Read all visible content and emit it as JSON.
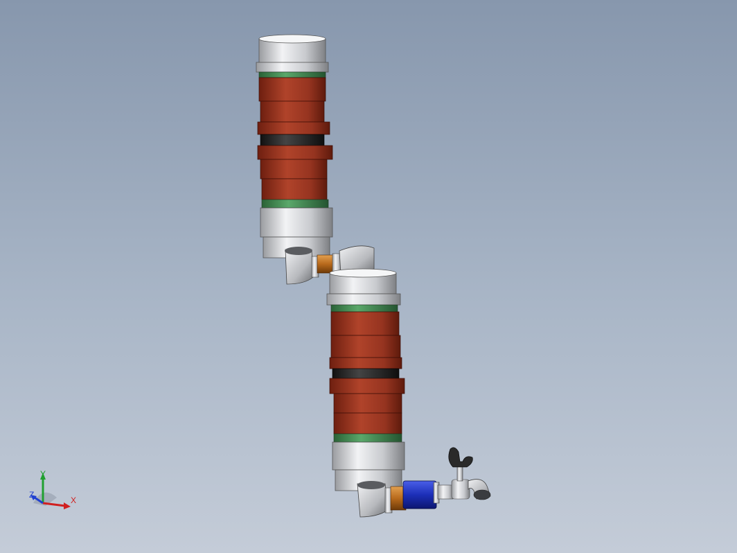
{
  "viewport": {
    "background_top": "#8797ad",
    "background_bottom": "#c4ccd8"
  },
  "model": {
    "body_color": "#a33a22",
    "seal_color": "#3f8a4c",
    "band_color": "#2b2b2b",
    "metal_color": "#d6d8dc",
    "coupling_color": "#b86a1c",
    "valve_body_color": "#1c2fb8",
    "handle_color": "#2a2a2a"
  },
  "triad": {
    "x_label": "X",
    "y_label": "Y",
    "z_label": "Z",
    "x_color": "#d02020",
    "y_color": "#20a030",
    "z_color": "#2040d0"
  }
}
